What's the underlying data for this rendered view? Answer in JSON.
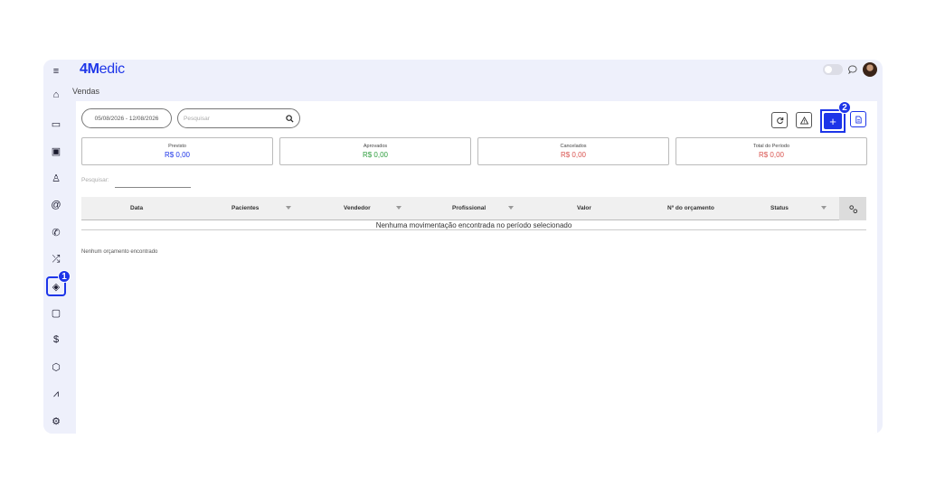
{
  "app": {
    "logo_bold": "4M",
    "logo_rest": "edic",
    "page_title": "Vendas"
  },
  "colors": {
    "accent": "#1d35e8",
    "positive": "#2e9e3e",
    "negative": "#d9534f"
  },
  "sidebar": {
    "items": [
      {
        "icon": "menu-icon",
        "glyph": "≡"
      },
      {
        "icon": "home-icon",
        "glyph": "⌂"
      },
      {
        "icon": "calendar-icon",
        "glyph": "▭"
      },
      {
        "icon": "inbox-icon",
        "glyph": "▣"
      },
      {
        "icon": "user-icon",
        "glyph": "♙"
      },
      {
        "icon": "at-icon",
        "glyph": "@"
      },
      {
        "icon": "phone-icon",
        "glyph": "✆"
      },
      {
        "icon": "shuffle-icon",
        "glyph": "⤮"
      },
      {
        "icon": "tag-icon",
        "glyph": "◈",
        "active": true
      },
      {
        "icon": "clipboard-icon",
        "glyph": "▢"
      },
      {
        "icon": "dollar-icon",
        "glyph": "$"
      },
      {
        "icon": "box-icon",
        "glyph": "⬡"
      },
      {
        "icon": "chart-icon",
        "glyph": "⩘"
      },
      {
        "icon": "settings-icon",
        "glyph": "⚙"
      }
    ]
  },
  "badges": {
    "first": "1",
    "second": "2"
  },
  "toolbar": {
    "date_range": "05/08/2026 - 12/08/2026",
    "search_placeholder": "Pesquisar",
    "add_label": "+"
  },
  "summary": [
    {
      "label": "Previsto",
      "value": "R$ 0,00",
      "color": "#1d35e8"
    },
    {
      "label": "Aprovados",
      "value": "R$ 0,00",
      "color": "#2e9e3e"
    },
    {
      "label": "Cancelados",
      "value": "R$ 0,00",
      "color": "#d9534f"
    },
    {
      "label": "Total do Período",
      "value": "R$ 0,00",
      "color": "#d9534f"
    }
  ],
  "filter": {
    "label": "Pesquisar:"
  },
  "table": {
    "columns": [
      "Data",
      "Pacientes",
      "Vendedor",
      "Profissional",
      "Valor",
      "Nº do orçamento",
      "Status"
    ],
    "empty_message": "Nenhuma movimentação encontrada no período selecionado"
  },
  "footer_note": "Nenhum orçamento encontrado"
}
